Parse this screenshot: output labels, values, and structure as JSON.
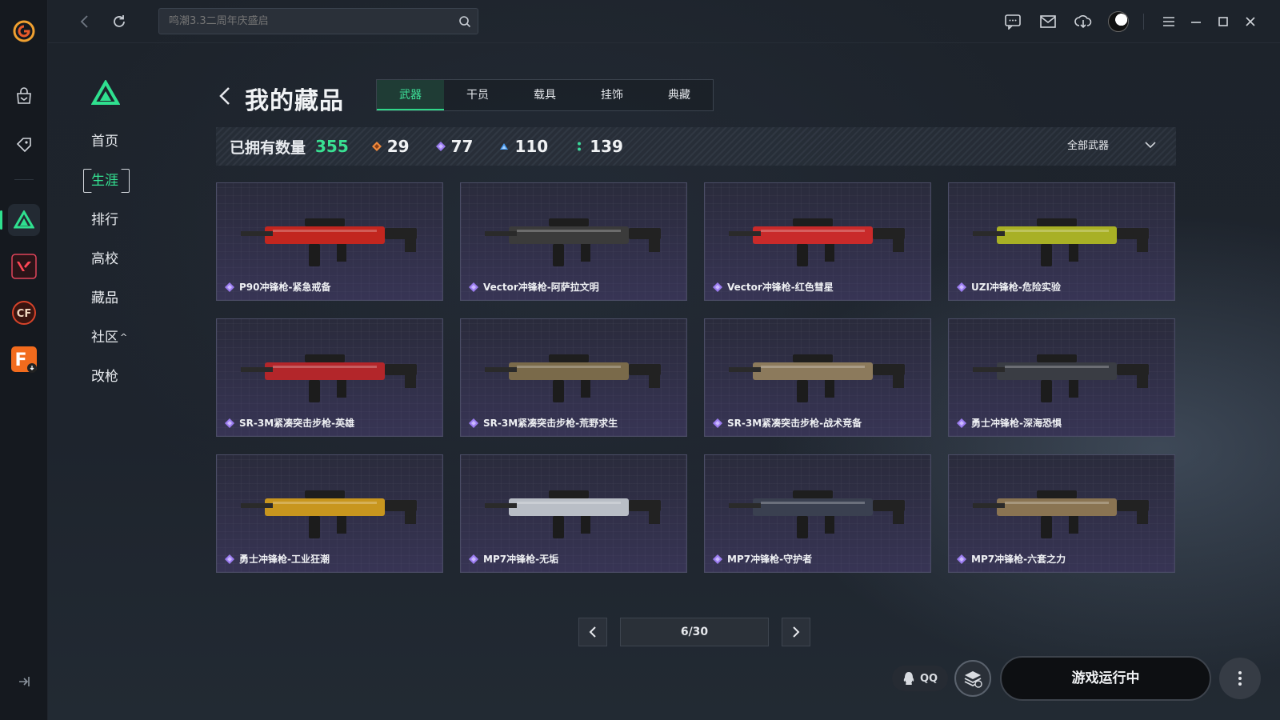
{
  "search": {
    "placeholder": "鸣潮3.3二周年庆盛启"
  },
  "sidemenu": {
    "items": [
      {
        "label": "首页"
      },
      {
        "label": "生涯"
      },
      {
        "label": "排行"
      },
      {
        "label": "高校"
      },
      {
        "label": "藏品"
      },
      {
        "label": "社区",
        "caret": "^"
      },
      {
        "label": "改枪"
      }
    ]
  },
  "header": {
    "title": "我的藏品",
    "tabs": [
      {
        "label": "武器"
      },
      {
        "label": "干员"
      },
      {
        "label": "载具"
      },
      {
        "label": "挂饰"
      },
      {
        "label": "典藏"
      }
    ]
  },
  "stats": {
    "label": "已拥有数量",
    "total": "355",
    "orange": "29",
    "purple": "77",
    "blue": "110",
    "green": "139",
    "filter": "全部武器"
  },
  "items": [
    {
      "name": "P90冲锋枪-紧急戒备",
      "color": "#c2261f"
    },
    {
      "name": "Vector冲锋枪-阿萨拉文明",
      "color": "#3b3b3b"
    },
    {
      "name": "Vector冲锋枪-红色彗星",
      "color": "#c92a2a"
    },
    {
      "name": "UZI冲锋枪-危险实验",
      "color": "#a8b025"
    },
    {
      "name": "SR-3M紧凑突击步枪-英雄",
      "color": "#b3262a"
    },
    {
      "name": "SR-3M紧凑突击步枪-荒野求生",
      "color": "#7a6a4a"
    },
    {
      "name": "SR-3M紧凑突击步枪-战术竞备",
      "color": "#8c7a5c"
    },
    {
      "name": "勇士冲锋枪-深海恐惧",
      "color": "#3a3d44"
    },
    {
      "name": "勇士冲锋枪-工业狂潮",
      "color": "#c8961e"
    },
    {
      "name": "MP7冲锋枪-无垢",
      "color": "#b9bec6"
    },
    {
      "name": "MP7冲锋枪-守护者",
      "color": "#3a4050"
    },
    {
      "name": "MP7冲锋枪-六套之力",
      "color": "#8a7452"
    }
  ],
  "pager": {
    "current": "6/30"
  },
  "bottom": {
    "qq": "QQ",
    "launch": "游戏运行中"
  },
  "colors": {
    "accent": "#34e392",
    "rarity_purple": "#9b7cf0",
    "rarity_orange": "#f08a3c",
    "rarity_blue": "#4a9bf0",
    "rarity_green": "#3ad89a"
  }
}
